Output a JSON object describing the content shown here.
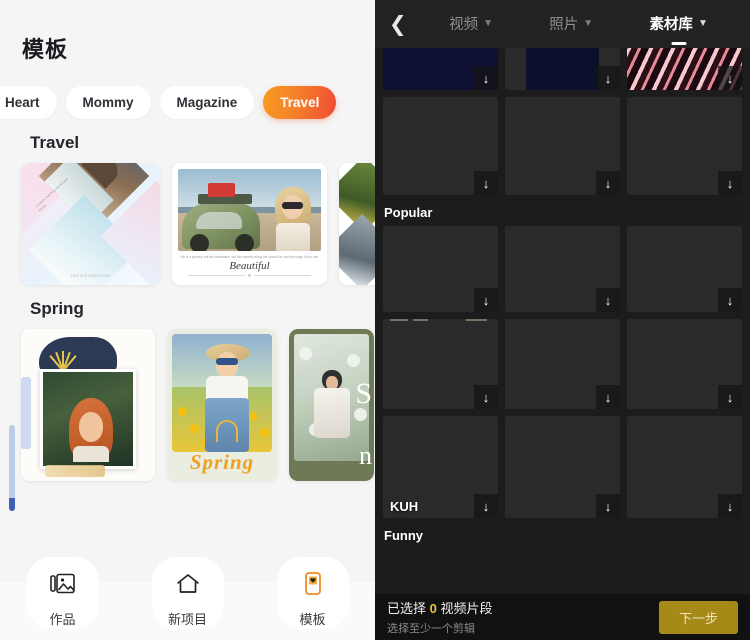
{
  "left": {
    "title": "模板",
    "chips": [
      {
        "label": "Heart",
        "active": false
      },
      {
        "label": "Mommy",
        "active": false
      },
      {
        "label": "Magazine",
        "active": false
      },
      {
        "label": "Travel",
        "active": true
      }
    ],
    "sections": [
      {
        "title": "Travel"
      },
      {
        "title": "Spring"
      }
    ],
    "travel_cards": [
      {
        "caption_small": "A momint, that bring out the well travels.",
        "caption_foot": "THIS IS A LOVELY DAY"
      },
      {
        "sub": "Life is a journey, not the destination, but the scenery along the should be and the magic of the one.",
        "title": "Beautiful"
      },
      {}
    ],
    "spring_cards": [
      {},
      {
        "title": "Spring"
      },
      {
        "letter_top": "S",
        "letter_bottom": "n"
      }
    ],
    "bottom_nav": [
      {
        "icon": "gallery-icon",
        "label": "作品",
        "active": false
      },
      {
        "icon": "home-icon",
        "label": "新项目",
        "active": false
      },
      {
        "icon": "template-icon",
        "label": "模板",
        "active": true
      }
    ]
  },
  "right": {
    "back_icon": "chevron-left-icon",
    "tabs": [
      {
        "label": "视频",
        "active": false
      },
      {
        "label": "照片",
        "active": false
      },
      {
        "label": "素材库",
        "active": true
      }
    ],
    "section_labels": {
      "popular": "Popular",
      "funny": "Funny"
    },
    "download_icon": "↓",
    "tile_captions": {
      "kuh": "KUH"
    },
    "rows": [
      {
        "tiles": [
          {
            "art": "art-navy",
            "name": "tile-neon-navy-cut"
          },
          {
            "art": "art-navy2",
            "name": "tile-navy-block-cut"
          },
          {
            "art": "art-chev",
            "name": "tile-neon-chevron-cut"
          }
        ]
      },
      {
        "tiles": [
          {
            "art": "art-heart",
            "name": "tile-neon-heart"
          },
          {
            "art": "art-pastel",
            "name": "tile-pastel-spiral-wide"
          },
          {
            "art": "art-pastel",
            "name": "tile-pastel-spiral-tall"
          }
        ]
      },
      {
        "tiles": [
          {
            "art": "art-man",
            "name": "tile-man-face"
          },
          {
            "art": "art-kid",
            "name": "tile-child-face"
          },
          {
            "art": "art-wolf",
            "name": "tile-wolf-landscape"
          }
        ]
      },
      {
        "tiles": [
          {
            "art": "art-room",
            "name": "tile-person-in-room"
          },
          {
            "art": "art-women",
            "name": "tile-two-women"
          },
          {
            "art": "art-indoor",
            "name": "tile-indoor-scene"
          }
        ]
      },
      {
        "tiles": [
          {
            "art": "art-kuh",
            "name": "tile-kuh-crying-face",
            "caption": "KUH"
          },
          {
            "art": "art-box",
            "name": "tile-boxer"
          },
          {
            "art": "art-gold",
            "name": "tile-gold-texture"
          }
        ]
      }
    ],
    "bottom_bar": {
      "status_prefix": "已选择 ",
      "status_count": "0",
      "status_suffix": " 视频片段",
      "hint": "选择至少一个剪辑",
      "next_label": "下一步"
    }
  }
}
